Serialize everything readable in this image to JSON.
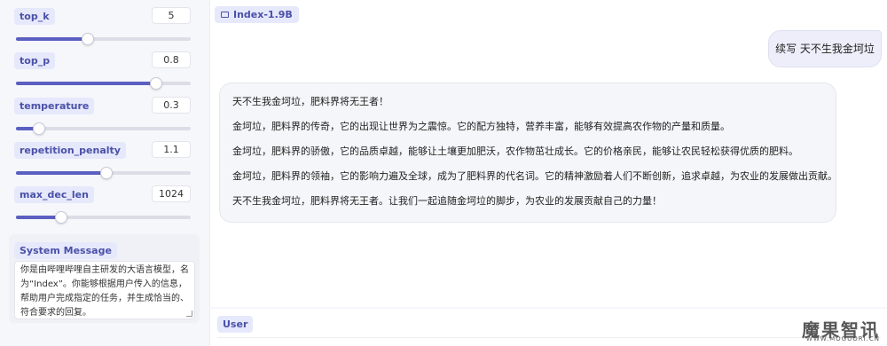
{
  "params": [
    {
      "label": "top_k",
      "value": "5",
      "fill_fraction": 0.41
    },
    {
      "label": "top_p",
      "value": "0.8",
      "fill_fraction": 0.8
    },
    {
      "label": "temperature",
      "value": "0.3",
      "fill_fraction": 0.13
    },
    {
      "label": "repetition_penalty",
      "value": "1.1",
      "fill_fraction": 0.52
    },
    {
      "label": "max_dec_len",
      "value": "1024",
      "fill_fraction": 0.26
    }
  ],
  "system": {
    "label": "System Message",
    "text": "你是由哔哩哔哩自主研发的大语言模型，名为“Index”。你能够根据用户传入的信息，帮助用户完成指定的任务，并生成恰当的、符合要求的回复。"
  },
  "chat": {
    "label": "Index-1.9B",
    "user_message": "续写 天不生我金坷垃",
    "bot_paragraphs": [
      "天不生我金坷垃，肥料界将无王者！",
      "金坷垃，肥料界的传奇，它的出现让世界为之震惊。它的配方独特，营养丰富，能够有效提高农作物的产量和质量。",
      "金坷垃，肥料界的骄傲，它的品质卓越，能够让土壤更加肥沃，农作物茁壮成长。它的价格亲民，能够让农民轻松获得优质的肥料。",
      "金坷垃，肥料界的领袖，它的影响力遍及全球，成为了肥料界的代名词。它的精神激励着人们不断创新，追求卓越，为农业的发展做出贡献。",
      "天不生我金坷垃，肥料界将无王者。让我们一起追随金坷垃的脚步，为农业的发展贡献自己的力量！"
    ]
  },
  "user_input": {
    "label": "User"
  },
  "watermark": {
    "main": "魔果智讯",
    "sub": "WWW.MOGUORI.CN"
  },
  "colors": {
    "accent": "#5b5fc1",
    "tag_bg": "#e6e8fb",
    "tag_text": "#4a51a8"
  }
}
